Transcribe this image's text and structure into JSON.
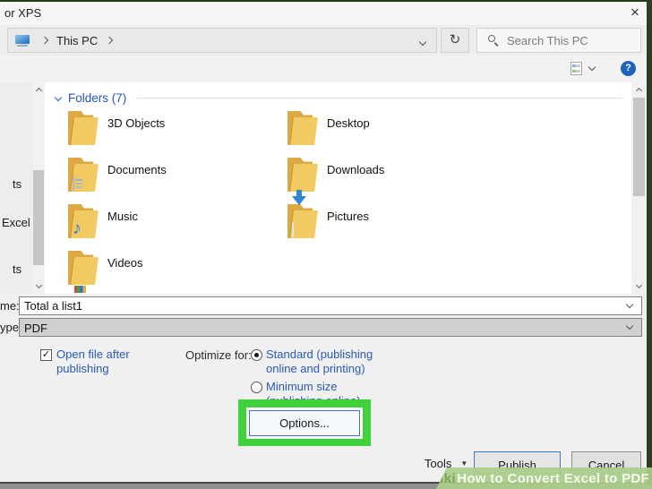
{
  "window": {
    "title_fragment": "or XPS"
  },
  "address_bar": {
    "breadcrumb_root": "This PC"
  },
  "search": {
    "placeholder": "Search This PC"
  },
  "help": {
    "glyph": "?"
  },
  "icons": {
    "close": "×",
    "refresh": "↻",
    "check": "✓",
    "dropdown_triangle": "▼",
    "music_note": "♪"
  },
  "sidebar": {
    "items": [
      {
        "label": "ts"
      },
      {
        "label": "Excel"
      },
      {
        "label": "ts"
      },
      {
        "label": "",
        "selected": true
      }
    ]
  },
  "folders": {
    "header": "Folders (7)",
    "items": [
      {
        "name": "3D Objects",
        "icon": "3d-cube"
      },
      {
        "name": "Documents",
        "icon": "document"
      },
      {
        "name": "Music",
        "icon": "music-note"
      },
      {
        "name": "Videos",
        "icon": "film-strip"
      },
      {
        "name": "Desktop",
        "icon": "monitor"
      },
      {
        "name": "Downloads",
        "icon": "down-arrow"
      },
      {
        "name": "Pictures",
        "icon": "photo"
      }
    ]
  },
  "file_name": {
    "label_fragment": "me:",
    "value": "Total a list1"
  },
  "save_type": {
    "label_fragment": "ype:",
    "value": "PDF"
  },
  "options": {
    "open_after": {
      "checked": true,
      "line1": "Open file after",
      "line2": "publishing"
    },
    "optimize_label": "Optimize for:",
    "standard": {
      "selected": true,
      "line1": "Standard (publishing",
      "line2": "online and printing)"
    },
    "minimum": {
      "selected": false,
      "line1": "Minimum size",
      "line2": "(publishing online)"
    },
    "options_button_label": "Options..."
  },
  "footer": {
    "tools_label": "Tools",
    "publish_label": "Publish",
    "cancel_label": "Cancel"
  },
  "watermark": {
    "brand": "wiki",
    "title": "How to Convert Excel to PDF"
  },
  "colors": {
    "accent_blue": "#2a5cb0",
    "selection_blue": "#abc8e8",
    "highlight_green": "#3ed13b",
    "watermark_green": "#abce8a",
    "help_blue": "#1f63bf",
    "folder_yellow": "#f1cb62"
  }
}
